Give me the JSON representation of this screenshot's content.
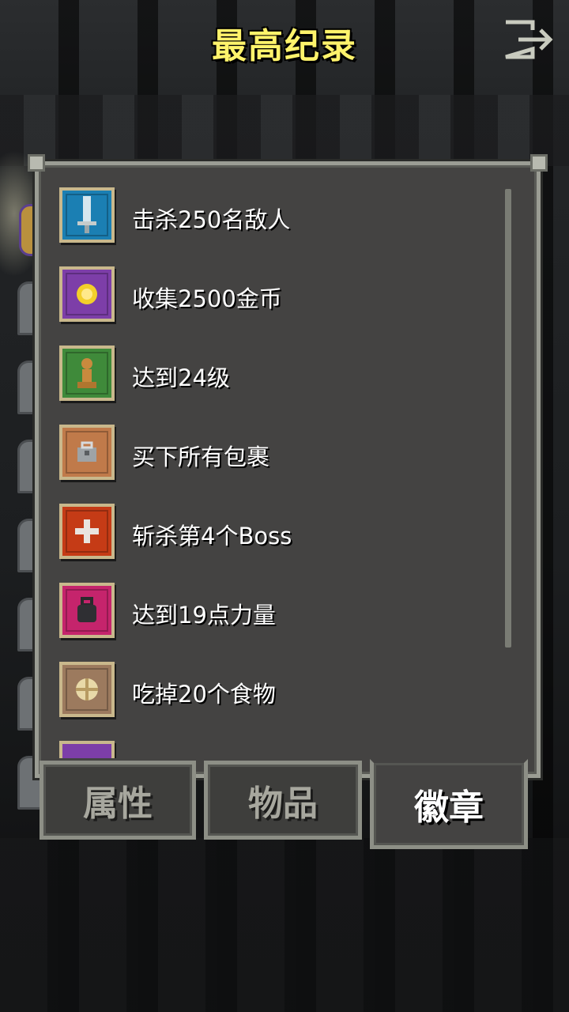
{
  "header": {
    "title": "最高纪录",
    "exit_icon": "exit-icon"
  },
  "badges": [
    {
      "label": "击杀250名敌人",
      "icon": "sword-icon",
      "color": "#1b7fb3"
    },
    {
      "label": "收集2500金币",
      "icon": "gold-coin-icon",
      "color": "#7d3ea8"
    },
    {
      "label": "达到24级",
      "icon": "pawn-icon",
      "color": "#3f8a3a"
    },
    {
      "label": "买下所有包裹",
      "icon": "bag-icon",
      "color": "#c07a4a"
    },
    {
      "label": "斩杀第4个Boss",
      "icon": "cross-icon",
      "color": "#c53b16"
    },
    {
      "label": "达到19点力量",
      "icon": "kettlebell-icon",
      "color": "#c5246c"
    },
    {
      "label": "吃掉20个食物",
      "icon": "pie-icon",
      "color": "#9c7a5e"
    }
  ],
  "tabs": [
    {
      "label": "属性",
      "active": false
    },
    {
      "label": "物品",
      "active": false
    },
    {
      "label": "徽章",
      "active": true
    }
  ]
}
